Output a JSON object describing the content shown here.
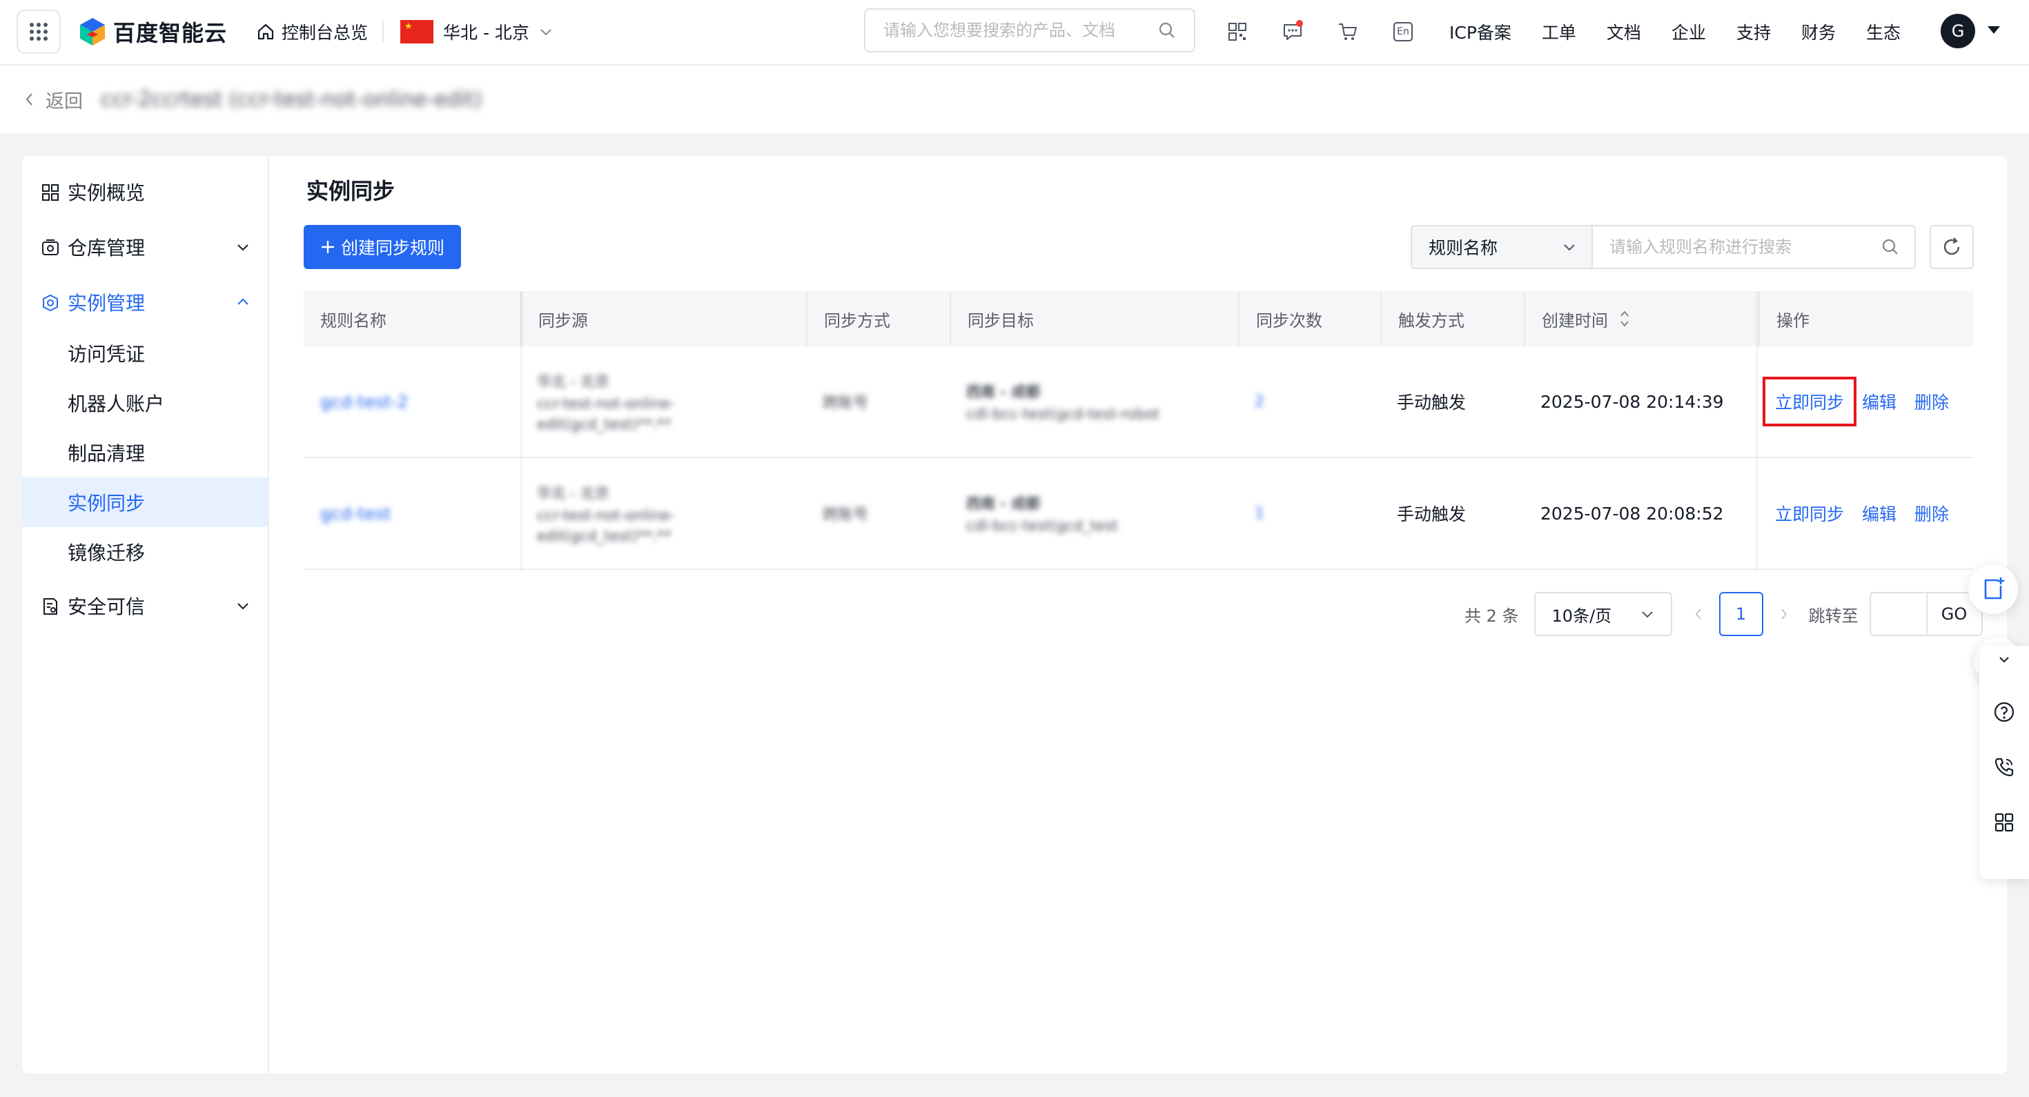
{
  "header": {
    "logo_text": "百度智能云",
    "overview_label": "控制台总览",
    "region_label": "华北 - 北京",
    "search_placeholder": "请输入您想要搜索的产品、文档",
    "links": [
      "ICP备案",
      "工单",
      "文档",
      "企业",
      "支持",
      "财务",
      "生态"
    ],
    "avatar_letter": "G",
    "en_label": "En"
  },
  "subbar": {
    "back_label": "返回",
    "instance_title": "ccr-2ccrtest (ccr-test-not-online-edit)"
  },
  "sidebar": {
    "items": [
      {
        "label": "实例概览"
      },
      {
        "label": "仓库管理"
      },
      {
        "label": "实例管理"
      },
      {
        "label": "访问凭证"
      },
      {
        "label": "机器人账户"
      },
      {
        "label": "制品清理"
      },
      {
        "label": "实例同步"
      },
      {
        "label": "镜像迁移"
      },
      {
        "label": "安全可信"
      }
    ]
  },
  "main": {
    "title": "实例同步",
    "create_button": "创建同步规则",
    "filter_select": "规则名称",
    "filter_placeholder": "请输入规则名称进行搜索"
  },
  "table": {
    "columns": [
      "规则名称",
      "同步源",
      "同步方式",
      "同步目标",
      "同步次数",
      "触发方式",
      "创建时间",
      "操作"
    ],
    "rows": [
      {
        "name": "gcd-test-2",
        "source_line1": "华北 - 北京",
        "source_line2": "ccr-test-not-online-",
        "source_line3": "edit(gcd_test)**:**",
        "method": "跨账号",
        "target_line1": "西南 - 成都",
        "target_line2": "cdl-bcc-test(gcd-test-robot",
        "count": "2",
        "trigger": "手动触发",
        "created": "2025-07-08 20:14:39",
        "ops": [
          "立即同步",
          "编辑",
          "删除"
        ]
      },
      {
        "name": "gcd-test",
        "source_line1": "华北 - 北京",
        "source_line2": "ccr-test-not-online-",
        "source_line3": "edit(gcd_test)**:**",
        "method": "跨账号",
        "target_line1": "西南 - 成都",
        "target_line2": "cdl-bcc-test(gcd_test",
        "count": "1",
        "trigger": "手动触发",
        "created": "2025-07-08 20:08:52",
        "ops": [
          "立即同步",
          "编辑",
          "删除"
        ]
      }
    ]
  },
  "pagination": {
    "total": "共 2 条",
    "page_size": "10条/页",
    "current_page": "1",
    "jump_label": "跳转至",
    "go_label": "GO"
  }
}
